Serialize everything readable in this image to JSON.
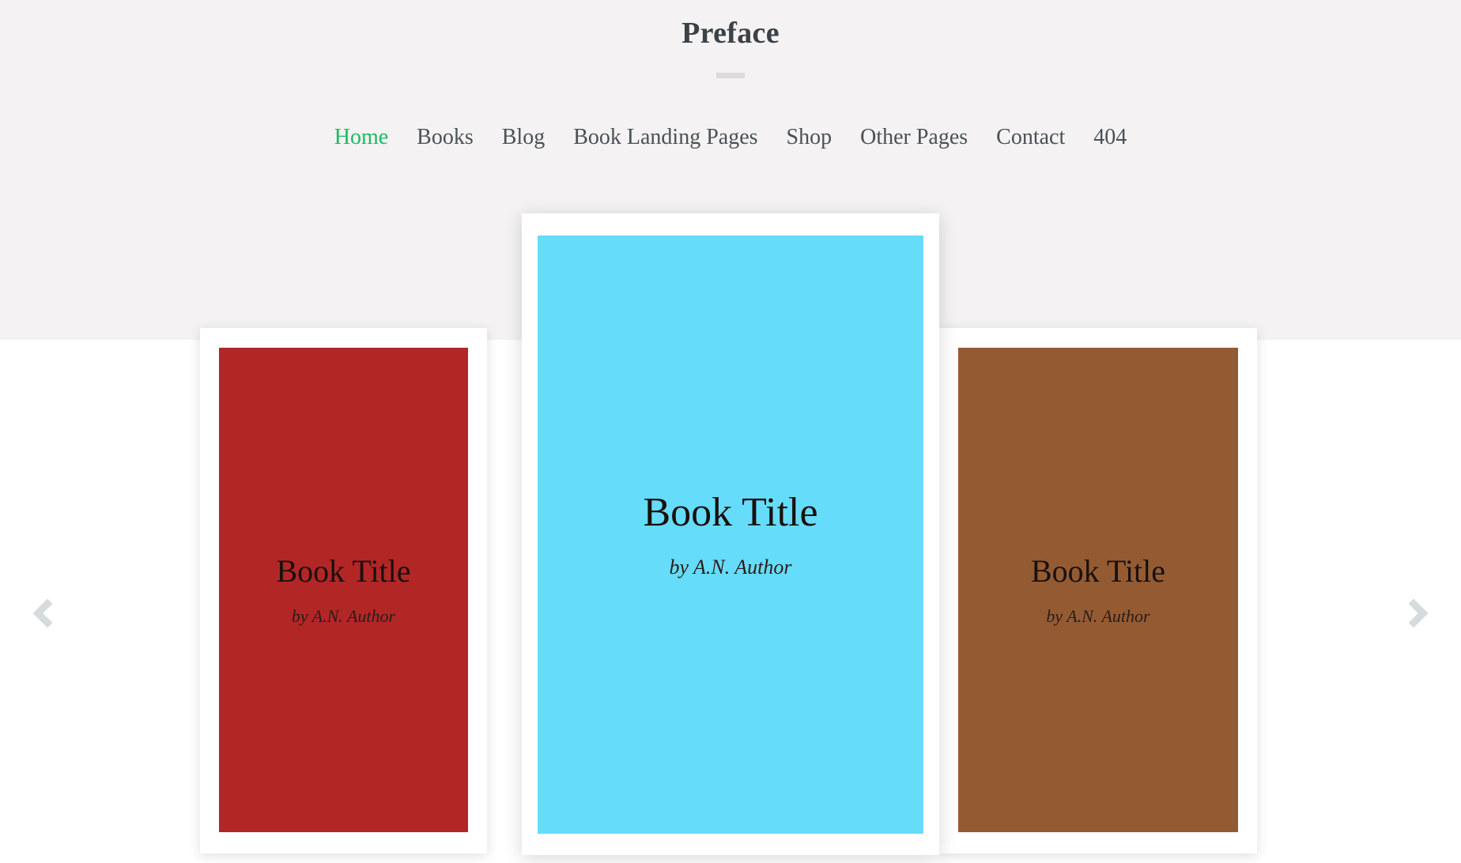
{
  "header": {
    "site_title": "Preface",
    "divider_color": "#dcdada",
    "background_color": "#f4f2f2"
  },
  "nav": {
    "active_color": "#18bb62",
    "default_color": "#4a5156",
    "items": [
      {
        "label": "Home",
        "active": true
      },
      {
        "label": "Books",
        "active": false
      },
      {
        "label": "Blog",
        "active": false
      },
      {
        "label": "Book Landing Pages",
        "active": false
      },
      {
        "label": "Shop",
        "active": false
      },
      {
        "label": "Other Pages",
        "active": false
      },
      {
        "label": "Contact",
        "active": false
      },
      {
        "label": "404",
        "active": false
      }
    ]
  },
  "carousel": {
    "prev_icon": "chevron-left-icon",
    "next_icon": "chevron-right-icon",
    "arrow_color": "#d6dbdd",
    "books": [
      {
        "position": "left",
        "title": "Book Title",
        "author": "by A.N. Author",
        "cover_color": "#b22626",
        "featured": false
      },
      {
        "position": "center",
        "title": "Book Title",
        "author": "by A.N. Author",
        "cover_color": "#66dcfb",
        "featured": true
      },
      {
        "position": "right",
        "title": "Book Title",
        "author": "by A.N. Author",
        "cover_color": "#945b33",
        "featured": false
      }
    ]
  }
}
